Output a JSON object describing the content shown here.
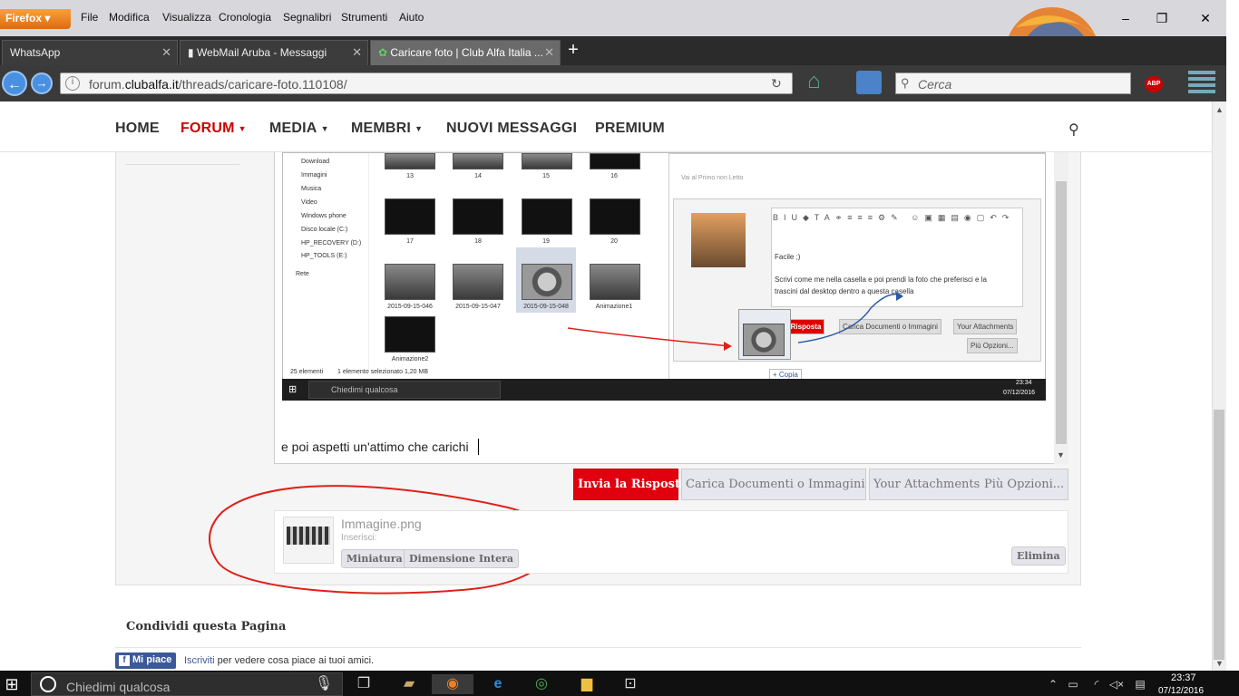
{
  "browser": {
    "app_button": "Firefox",
    "menu": [
      "File",
      "Modifica",
      "Visualizza",
      "Cronologia",
      "Segnalibri",
      "Strumenti",
      "Aiuto"
    ],
    "tabs": [
      {
        "label": "WhatsApp"
      },
      {
        "label": "WebMail Aruba - Messaggi"
      },
      {
        "label": "Caricare foto | Club Alfa Italia ..."
      }
    ],
    "url_prefix": "forum.",
    "url_domain": "clubalfa.it",
    "url_path": "/threads/caricare-foto.110108/",
    "search_placeholder": "Cerca"
  },
  "site_nav": {
    "items": [
      "HOME",
      "FORUM",
      "MEDIA",
      "MEMBRI",
      "NUOVI MESSAGGI",
      "PREMIUM"
    ],
    "active": "FORUM"
  },
  "embedded_screenshot": {
    "tree": [
      "Download",
      "Immagini",
      "Musica",
      "Video",
      "Windows phone",
      "Disco locale (C:)",
      "HP_RECOVERY (D:)",
      "HP_TOOLS (E:)",
      "Rete"
    ],
    "thumb_labels_row1": [
      "13",
      "14",
      "15",
      "16"
    ],
    "thumb_labels_row2": [
      "17",
      "18",
      "19",
      "20"
    ],
    "thumb_labels_row3": [
      "2015-09-15-046",
      "2015-09-15-047",
      "2015-09-15-048",
      "Animazione1"
    ],
    "thumb_label_row4": "Animazione2",
    "status_left": "25 elementi",
    "status_mid": "1 elemento selezionato  1,20 MB",
    "unread_link": "Vai al Primo non Letto",
    "reply_line1": "Facile ;)",
    "reply_line2": "Scrivi come me nella casella e poi prendi la foto che preferisci e la",
    "reply_line3": "trascini dal desktop dentro a questa casella",
    "btn_reply": "a la Risposta",
    "btn_upload": "Carica Documenti o Immagini",
    "btn_attachments": "Your Attachments",
    "btn_more": "Più Opzioni...",
    "copy_label": "+ Copia",
    "taskbar_search": "Chiedimi qualcosa",
    "clock_time": "23:34",
    "clock_date": "07/12/2016"
  },
  "editor": {
    "text": "e poi aspetti un'attimo che carichi"
  },
  "form_buttons": {
    "reply": "Invia la Risposta",
    "upload": "Carica Documenti o Immagini",
    "attachments": "Your Attachments",
    "more": "Più Opzioni..."
  },
  "attachment": {
    "filename": "Immagine.png",
    "insert_label": "Inserisci:",
    "thumb_btn": "Miniatura",
    "full_btn": "Dimensione Intera",
    "delete_btn": "Elimina"
  },
  "share": {
    "title": "Condividi questa Pagina",
    "like_label": "Mi piace",
    "signup_link": "Iscriviti",
    "signup_suffix": " per vedere cosa piace ai tuoi amici."
  },
  "taskbar": {
    "search_placeholder": "Chiedimi qualcosa",
    "time": "23:37",
    "date": "07/12/2016"
  },
  "colors": {
    "accent_red": "#e00010",
    "annotation_red": "#e0201a",
    "annotation_blue": "#2a5aa8"
  }
}
